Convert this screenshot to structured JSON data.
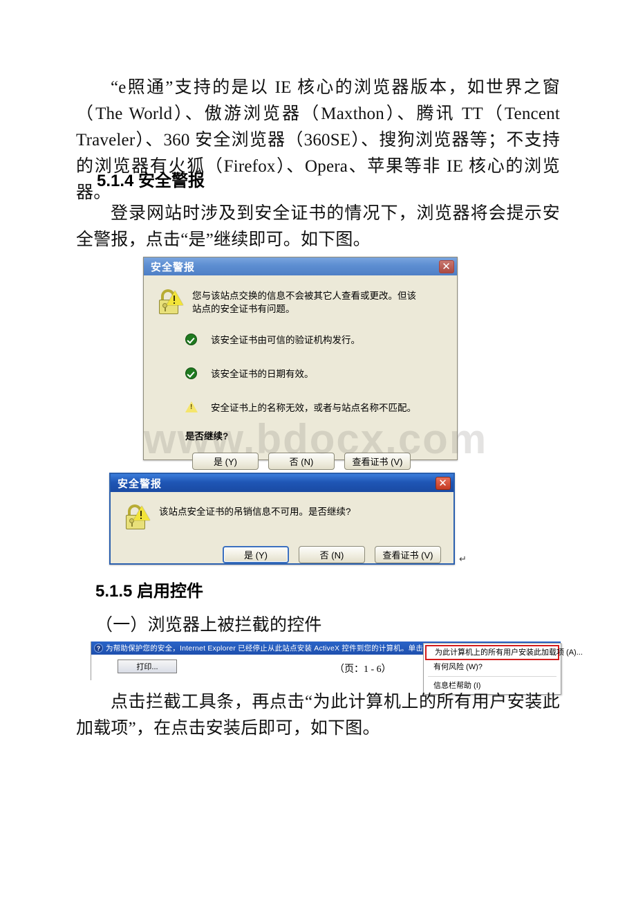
{
  "document": {
    "paragraphs": {
      "intro": "“e照通”支持的是以 IE 核心的浏览器版本，如世界之窗（The World）、傲游浏览器（Maxthon）、腾讯 TT（Tencent Traveler）、360 安全浏览器（360SE）、搜狗浏览器等；不支持的浏览器有火狐（Firefox）、Opera、苹果等非 IE 核心的浏览器。",
      "sec514_body": "登录网站时涉及到安全证书的情况下，浏览器将会提示安全警报，点击“是”继续即可。如下图。",
      "sec515_sub": "（一）浏览器上被拦截的控件",
      "sec515_body": "点击拦截工具条，再点击“为此计算机上的所有用户安装此加载项”，在点击安装后即可，如下图。"
    },
    "headings": {
      "sec514": "5.1.4 安全警报",
      "sec515": "5.1.5 启用控件"
    }
  },
  "watermark": {
    "text": "www.bdocx.com"
  },
  "dialog1": {
    "title": "安全警报",
    "close_label": "✕",
    "message": "您与该站点交换的信息不会被其它人查看或更改。但该站点的安全证书有问题。",
    "items": [
      {
        "icon": "ok",
        "text": "该安全证书由可信的验证机构发行。"
      },
      {
        "icon": "ok",
        "text": "该安全证书的日期有效。"
      },
      {
        "icon": "warn",
        "text": "安全证书上的名称无效，或者与站点名称不匹配。"
      }
    ],
    "prompt": "是否继续?",
    "buttons": [
      {
        "label": "是 (Y)",
        "default": false
      },
      {
        "label": "否 (N)",
        "default": false
      },
      {
        "label": "查看证书 (V)",
        "default": false
      }
    ]
  },
  "dialog2": {
    "title": "安全警报",
    "close_label": "✕",
    "message": "该站点安全证书的吊销信息不可用。是否继续?",
    "buttons": [
      {
        "label": "是 (Y)",
        "default": true
      },
      {
        "label": "否 (N)",
        "default": false
      },
      {
        "label": "查看证书 (V)",
        "default": false
      }
    ],
    "paragraph_mark": "↵"
  },
  "ie_screenshot": {
    "infobar": {
      "icon": "question-mark-icon",
      "text": "为帮助保护您的安全，Internet Explorer 已经停止从此站点安装 ActiveX 控件到您的计算机。单击此处查看选项..."
    },
    "toolbar": {
      "print_button": "打印...",
      "page_label": "（页：1 - 6）"
    },
    "context_menu": {
      "items": [
        {
          "label": "为此计算机上的所有用户安装此加载项 (A)...",
          "highlighted": true
        },
        {
          "label": "有何风险 (W)?",
          "highlighted": false
        },
        {
          "label": "信息栏帮助 (I)",
          "highlighted": false
        }
      ]
    }
  },
  "colors": {
    "dialog_face": "#ece9d8",
    "titlebar_blue": "#1e4fae",
    "close_red": "#b5544c",
    "ok_green": "#1f7a1f",
    "warn_yellow": "#f5e56b",
    "highlight_red": "#d41b1b"
  }
}
